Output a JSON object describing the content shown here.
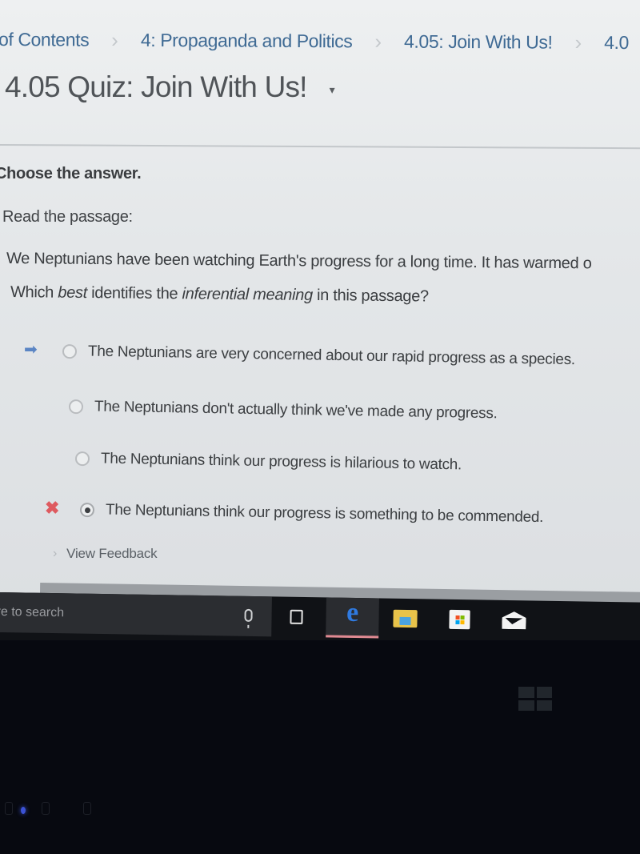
{
  "breadcrumb": {
    "items": [
      {
        "label": "of Contents"
      },
      {
        "label": "4: Propaganda and Politics"
      },
      {
        "label": "4.05: Join With Us!"
      },
      {
        "label": "4.0"
      }
    ]
  },
  "page": {
    "title": "4.05 Quiz: Join With Us!",
    "title_caret": "▾"
  },
  "quiz": {
    "instruction": "Choose the answer.",
    "read_label": "Read the passage:",
    "passage": "We Neptunians have been watching Earth's progress for a long time. It has warmed o",
    "question": {
      "part1": "Which ",
      "emph1": "best",
      "part2": " identifies the ",
      "emph2": "inferential meaning",
      "part3": " in this passage?"
    },
    "options": [
      {
        "label": "The Neptunians are very concerned about our rapid progress as a species.",
        "selected": false,
        "marker": "correct-arrow"
      },
      {
        "label": "The Neptunians don't actually think we've made any progress.",
        "selected": false,
        "marker": ""
      },
      {
        "label": "The Neptunians think our progress is hilarious to watch.",
        "selected": false,
        "marker": ""
      },
      {
        "label": "The Neptunians think our progress is something to be commended.",
        "selected": true,
        "marker": "incorrect-x"
      }
    ],
    "markers": {
      "arrow": "➡",
      "x": "✖"
    },
    "feedback_chevron": "›",
    "view_feedback": "View Feedback"
  },
  "taskbar": {
    "search_placeholder": "re to search",
    "icons": [
      "microphone-icon",
      "task-view-icon",
      "edge-icon",
      "file-explorer-icon",
      "store-icon",
      "mail-icon"
    ],
    "edge_glyph": "e",
    "active_app": "edge",
    "active_underline_color": "#e08a92"
  },
  "colors": {
    "link": "#3f6a94",
    "arrow_marker": "#5b85c4",
    "x_marker": "#de5a5f"
  }
}
